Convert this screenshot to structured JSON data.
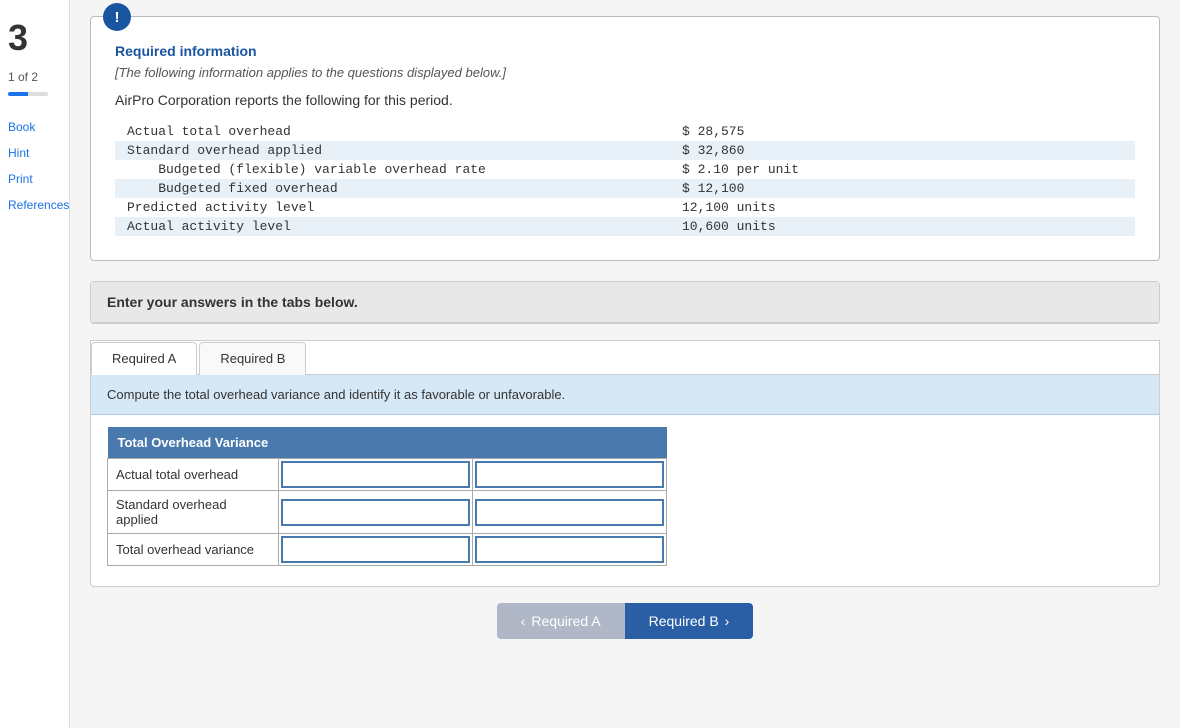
{
  "sidebar": {
    "number": "3",
    "page_info": "1 of 2",
    "links": [
      "Book",
      "Hint",
      "Print",
      "References"
    ]
  },
  "info_box": {
    "title": "Required information",
    "subtitle": "[The following information applies to the questions displayed below.]",
    "intro": "AirPro Corporation reports the following for this period.",
    "rows": [
      {
        "label": "Actual total overhead",
        "value": "$ 28,575",
        "shaded": false
      },
      {
        "label": "Standard overhead applied",
        "value": "$ 32,860",
        "shaded": true
      },
      {
        "label": "    Budgeted (flexible) variable overhead rate",
        "value": "$ 2.10 per unit",
        "shaded": false
      },
      {
        "label": "    Budgeted fixed overhead",
        "value": "$ 12,100",
        "shaded": true
      },
      {
        "label": "Predicted activity level",
        "value": "12,100 units",
        "shaded": false
      },
      {
        "label": "Actual activity level",
        "value": "10,600 units",
        "shaded": true
      }
    ]
  },
  "answer_header": "Enter your answers in the tabs below.",
  "tabs": [
    {
      "label": "Required A",
      "active": true
    },
    {
      "label": "Required B",
      "active": false
    }
  ],
  "tab_description": "Compute the total overhead variance and identify it as favorable or unfavorable.",
  "variance_table": {
    "header": "Total Overhead Variance",
    "rows": [
      {
        "label": "Actual total overhead",
        "col1": "",
        "col2": ""
      },
      {
        "label": "Standard overhead applied",
        "col1": "",
        "col2": ""
      },
      {
        "label": "Total overhead variance",
        "col1": "",
        "col2": ""
      }
    ]
  },
  "nav_buttons": {
    "prev_label": "Required A",
    "next_label": "Required B"
  }
}
